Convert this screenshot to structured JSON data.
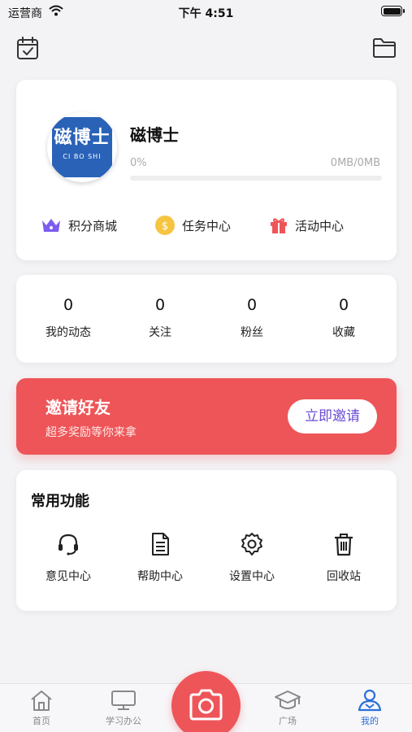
{
  "status_bar": {
    "carrier": "运营商",
    "time": "下午 4:51"
  },
  "header": {
    "left_icon": "calendar-check-icon",
    "right_icon": "folder-icon"
  },
  "profile": {
    "avatar_logo_text": "磁博士",
    "avatar_logo_subtext": "CI BO SHI",
    "username": "磁博士",
    "storage_percent_label": "0%",
    "storage_usage": "0MB/0MB",
    "storage_fraction": 0
  },
  "quick_links": [
    {
      "label": "积分商城",
      "icon": "crown-icon",
      "color": "#7b5cf0"
    },
    {
      "label": "任务中心",
      "icon": "coin-icon",
      "color": "#f5c542"
    },
    {
      "label": "活动中心",
      "icon": "gift-icon",
      "color": "#ee5558"
    }
  ],
  "stats": [
    {
      "value": "0",
      "label": "我的动态"
    },
    {
      "value": "0",
      "label": "关注"
    },
    {
      "value": "0",
      "label": "粉丝"
    },
    {
      "value": "0",
      "label": "收藏"
    }
  ],
  "invite": {
    "title": "邀请好友",
    "subtitle": "超多奖励等你来拿",
    "button": "立即邀请"
  },
  "functions": {
    "title": "常用功能",
    "items": [
      {
        "label": "意见中心",
        "icon": "headset-icon"
      },
      {
        "label": "帮助中心",
        "icon": "document-icon"
      },
      {
        "label": "设置中心",
        "icon": "gear-icon"
      },
      {
        "label": "回收站",
        "icon": "trash-icon"
      }
    ]
  },
  "tab_bar": {
    "tabs": [
      {
        "label": "首页",
        "icon": "home-icon",
        "active": false
      },
      {
        "label": "学习办公",
        "icon": "monitor-icon",
        "active": false
      },
      {
        "label": "广场",
        "icon": "graduation-cap-icon",
        "active": false
      },
      {
        "label": "我的",
        "icon": "user-icon",
        "active": true
      }
    ],
    "center_button_icon": "camera-icon"
  },
  "colors": {
    "accent_red": "#ee5558",
    "active_blue": "#2a6fdc",
    "invite_button_text": "#6a4bd6"
  }
}
